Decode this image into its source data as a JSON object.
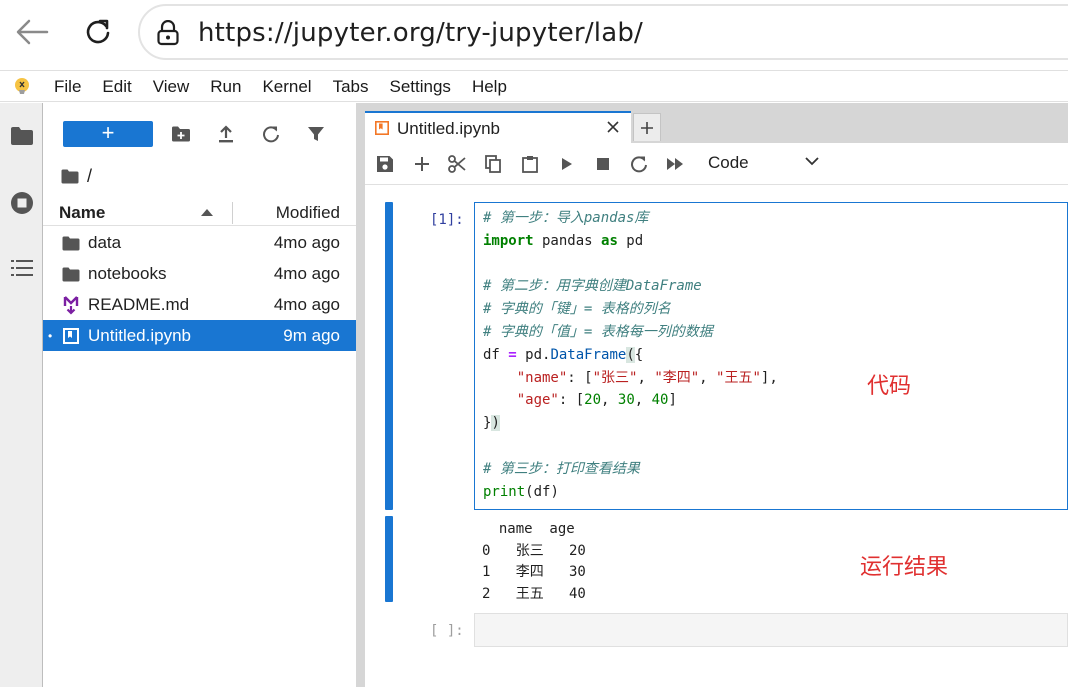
{
  "browser": {
    "url": "https://jupyter.org/try-jupyter/lab/"
  },
  "menubar": {
    "items": [
      "File",
      "Edit",
      "View",
      "Run",
      "Kernel",
      "Tabs",
      "Settings",
      "Help"
    ]
  },
  "filebrowser": {
    "new_label": "+",
    "breadcrumb": "/",
    "header": {
      "name": "Name",
      "modified": "Modified"
    },
    "files": [
      {
        "name": "data",
        "modified": "4mo ago",
        "icon": "folder-icon"
      },
      {
        "name": "notebooks",
        "modified": "4mo ago",
        "icon": "folder-icon"
      },
      {
        "name": "README.md",
        "modified": "4mo ago",
        "icon": "markdown-icon"
      },
      {
        "name": "Untitled.ipynb",
        "modified": "9m ago",
        "icon": "notebook-icon",
        "selected": true,
        "running_dot": "•"
      }
    ]
  },
  "notebook": {
    "tab_title": "Untitled.ipynb",
    "cell_type": "Code",
    "cells": [
      {
        "prompt": "[1]:",
        "code_lines": [
          "# 第一步：导入pandas库",
          "import pandas as pd",
          "",
          "# 第二步：用字典创建DataFrame",
          "# 字典的「键」= 表格的列名",
          "# 字典的「值」= 表格每一列的数据",
          "df = pd.DataFrame({",
          "    \"name\": [\"张三\", \"李四\", \"王五\"],",
          "    \"age\": [20, 30, 40]",
          "})",
          "",
          "# 第三步：打印查看结果",
          "print(df)"
        ],
        "output_lines": [
          "  name  age",
          "0   张三   20",
          "1   李四   30",
          "2   王五   40"
        ]
      },
      {
        "prompt": "[ ]:"
      }
    ],
    "annotations": {
      "code": "代码",
      "result": "运行结果"
    }
  },
  "colors": {
    "accent": "#1976d2",
    "annotation": "#e03030",
    "comment": "#408080",
    "keyword": "#008000",
    "string": "#ba2121"
  }
}
